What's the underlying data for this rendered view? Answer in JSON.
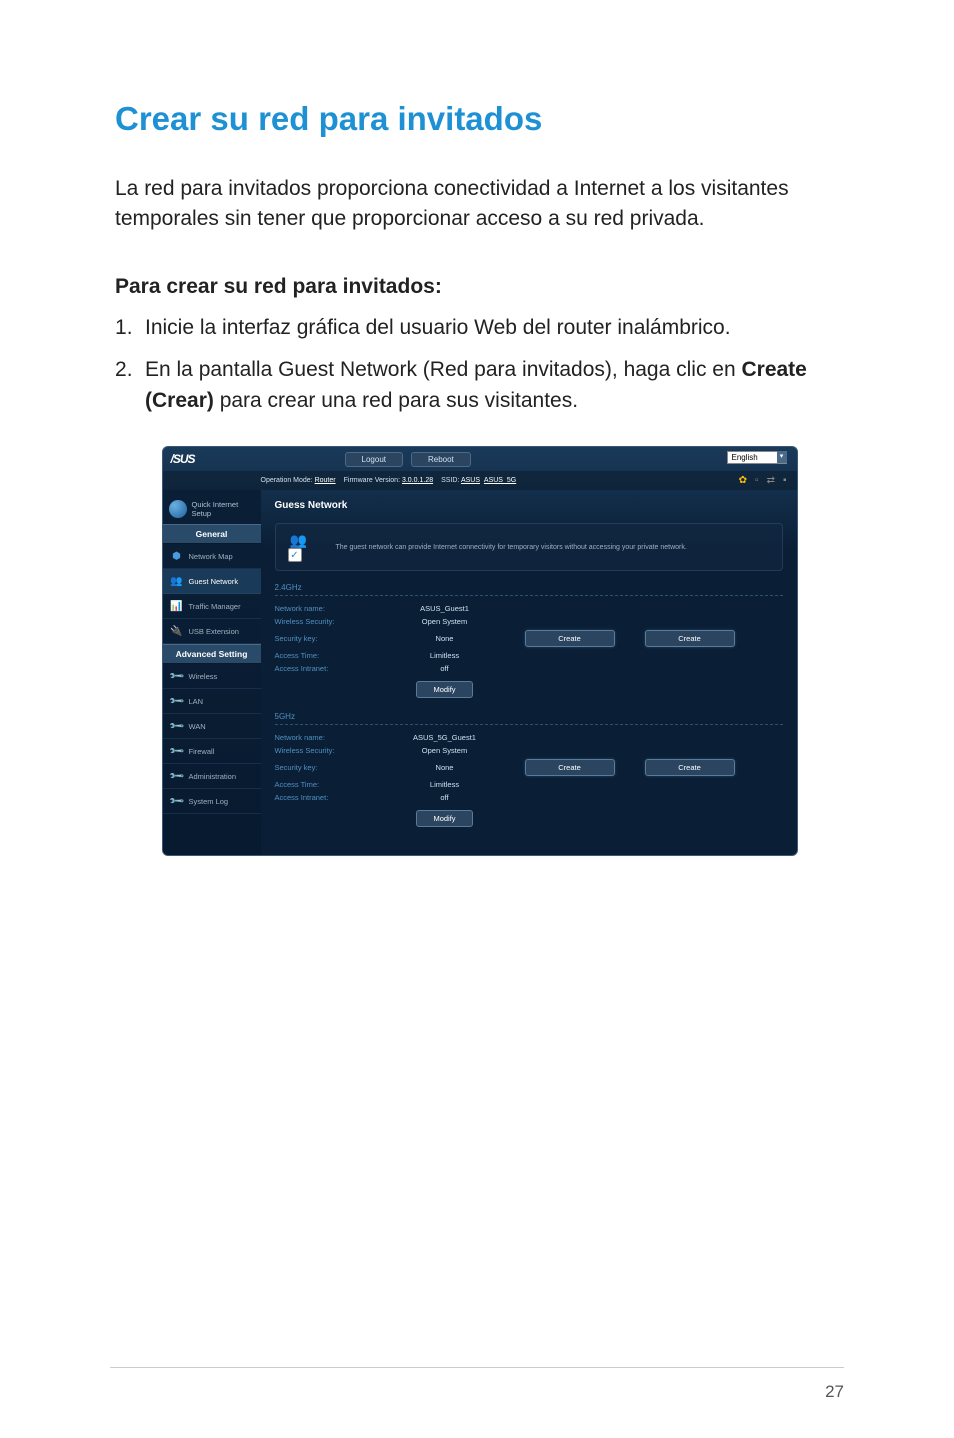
{
  "page": {
    "title": "Crear su red para invitados",
    "intro": "La red para invitados proporciona conectividad a Internet a los visitantes temporales sin tener que proporcionar acceso a su red privada.",
    "sub_heading": "Para crear su red para invitados:",
    "step1": "Inicie la interfaz gráfica del usuario Web del router inalámbrico.",
    "step2_a": "En la pantalla Guest Network (Red para invitados), haga clic en ",
    "step2_bold": "Create (Crear)",
    "step2_b": " para crear una red para sus visitantes.",
    "number": "27"
  },
  "router": {
    "brand": "/SUS",
    "logout_btn": "Logout",
    "reboot_btn": "Reboot",
    "language": "English",
    "status": {
      "op_mode_label": "Operation Mode: ",
      "op_mode_value": "Router",
      "fw_label": "Firmware Version: ",
      "fw_value": "3.0.0.1.28",
      "ssid_label": "SSID: ",
      "ssid1": "ASUS",
      "ssid2": "ASUS_5G"
    },
    "sidebar": {
      "qis": "Quick Internet Setup",
      "general": "General",
      "network_map": "Network Map",
      "guest_network": "Guest Network",
      "traffic_manager": "Traffic Manager",
      "usb_extension": "USB Extension",
      "advanced": "Advanced Setting",
      "wireless": "Wireless",
      "lan": "LAN",
      "wan": "WAN",
      "firewall": "Firewall",
      "administration": "Administration",
      "system_log": "System Log"
    },
    "content": {
      "title": "Guess Network",
      "description": "The guest network can provide Internet connectivity for temporary visitors without accessing your private network.",
      "band_24": "2.4GHz",
      "band_5": "5GHz",
      "labels": {
        "network_name": "Network name:",
        "wireless_security": "Wireless Security:",
        "security_key": "Security key:",
        "access_time": "Access Time:",
        "access_intranet": "Access Intranet:"
      },
      "values_24": {
        "network_name": "ASUS_Guest1",
        "wireless_security": "Open System",
        "security_key": "None",
        "access_time": "Limitless",
        "access_intranet": "off"
      },
      "values_5": {
        "network_name": "ASUS_5G_Guest1",
        "wireless_security": "Open System",
        "security_key": "None",
        "access_time": "Limitless",
        "access_intranet": "off"
      },
      "create_btn": "Create",
      "modify_btn": "Modify"
    }
  }
}
